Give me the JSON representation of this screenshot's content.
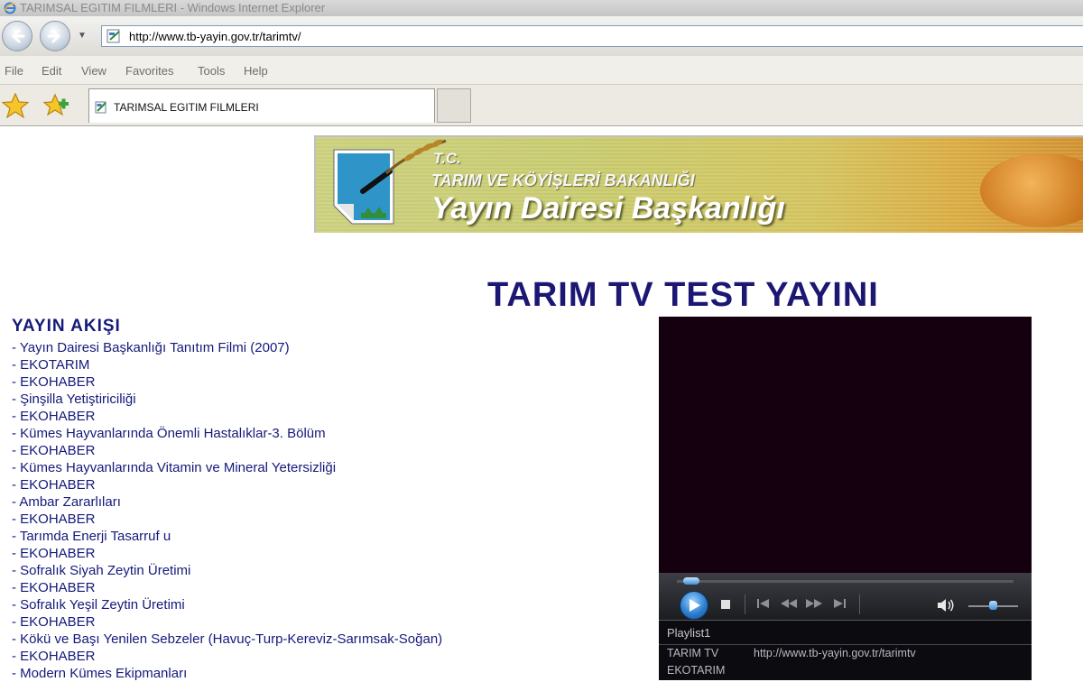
{
  "window": {
    "title": "TARIMSAL EGITIM FILMLERI - Windows Internet Explorer"
  },
  "navigation": {
    "address_url": "http://www.tb-yayin.gov.tr/tarimtv/"
  },
  "menu": {
    "items": [
      "File",
      "Edit",
      "View",
      "Favorites",
      "Tools",
      "Help"
    ]
  },
  "favorites_bar": {
    "tab_label": "TARIMSAL EGITIM FILMLERI"
  },
  "banner": {
    "tc": "T.C.",
    "ministry": "TARIM VE KÖYİŞLERİ BAKANLIĞI",
    "department": "Yayın Dairesi Başkanlığı"
  },
  "page": {
    "heading": "TARIM TV TEST YAYINI"
  },
  "schedule": {
    "title": "YAYIN AKIŞI",
    "items": [
      "- Yayın Dairesi Başkanlığı Tanıtım Filmi (2007)",
      "- EKOTARIM",
      "- EKOHABER",
      "- Şinşilla Yetiştiriciliği",
      "- EKOHABER",
      "- Kümes Hayvanlarında Önemli Hastalıklar-3. Bölüm",
      "- EKOHABER",
      "- Kümes Hayvanlarında Vitamin ve Mineral Yetersizliği",
      "- EKOHABER",
      "- Ambar Zararlıları",
      "- EKOHABER",
      "- Tarımda Enerji Tasarruf u",
      "- EKOHABER",
      "- Sofralık Siyah Zeytin Üretimi",
      "- EKOHABER",
      "- Sofralık Yeşil Zeytin Üretimi",
      "- EKOHABER",
      "- Kökü ve Başı Yenilen Sebzeler (Havuç-Turp-Kereviz-Sarımsak-Soğan)",
      "- EKOHABER",
      "- Modern Kümes Ekipmanları"
    ]
  },
  "player": {
    "seek_progress": 0.02,
    "volume_level": 0.5,
    "playlist_name": "Playlist1",
    "playlist": [
      {
        "title": "TARIM TV",
        "url": "http://www.tb-yayin.gov.tr/tarimtv"
      },
      {
        "title": "EKOTARIM",
        "url": ""
      }
    ]
  },
  "colors": {
    "link": "#15197a",
    "heading": "#1c1773",
    "player_bg": "#14000e"
  }
}
